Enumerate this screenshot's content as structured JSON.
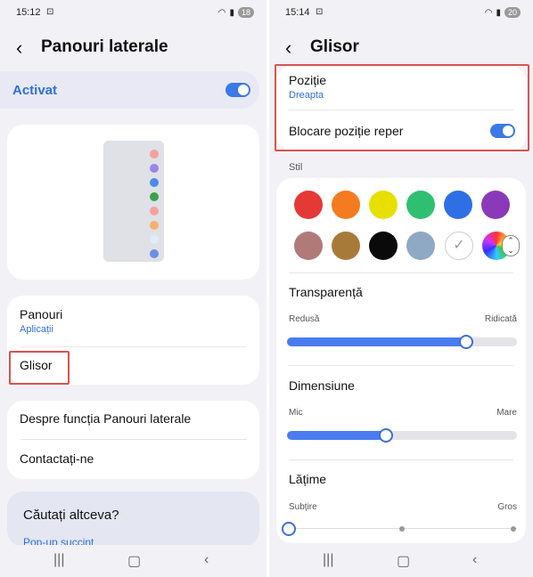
{
  "left": {
    "status": {
      "time": "15:12",
      "battery": "18"
    },
    "header": {
      "title": "Panouri laterale"
    },
    "activated": {
      "label": "Activat",
      "on": true
    },
    "preview": {
      "dot_colors": [
        "#f4a0a0",
        "#9b85e8",
        "#4e8ae6",
        "#3aa34a",
        "#f4a0a0",
        "#f6b070",
        "#e0ecf8",
        "#6a8fe8"
      ]
    },
    "panels": {
      "label": "Panouri",
      "sub": "Aplicații"
    },
    "slider_item": {
      "label": "Glisor"
    },
    "about": {
      "label": "Despre funcția Panouri laterale"
    },
    "contact": {
      "label": "Contactați-ne"
    },
    "search_card": {
      "title": "Căutați altceva?",
      "link": "Pop-up succint"
    }
  },
  "right": {
    "status": {
      "time": "15:14",
      "battery": "20"
    },
    "header": {
      "title": "Glisor"
    },
    "position": {
      "label": "Poziție",
      "value": "Dreapta"
    },
    "lock": {
      "label": "Blocare poziție reper",
      "on": true
    },
    "style_label": "Stil",
    "swatches": [
      "#e53935",
      "#f47b20",
      "#e6df00",
      "#2ec070",
      "#2f6fe6",
      "#8a3ab9",
      "#b07a78",
      "#a87a3a",
      "#0a0a0a",
      "#8fa9c4"
    ],
    "transparency": {
      "label": "Transparență",
      "min": "Redusă",
      "max": "Ridicată",
      "value": 0.78
    },
    "size": {
      "label": "Dimensiune",
      "min": "Mic",
      "max": "Mare",
      "value": 0.43
    },
    "width": {
      "label": "Lățime",
      "min": "Subțire",
      "max": "Gros",
      "value": 0.0
    }
  },
  "colors": {
    "accent": "#3b79e6",
    "highlight": "#d9534f"
  }
}
